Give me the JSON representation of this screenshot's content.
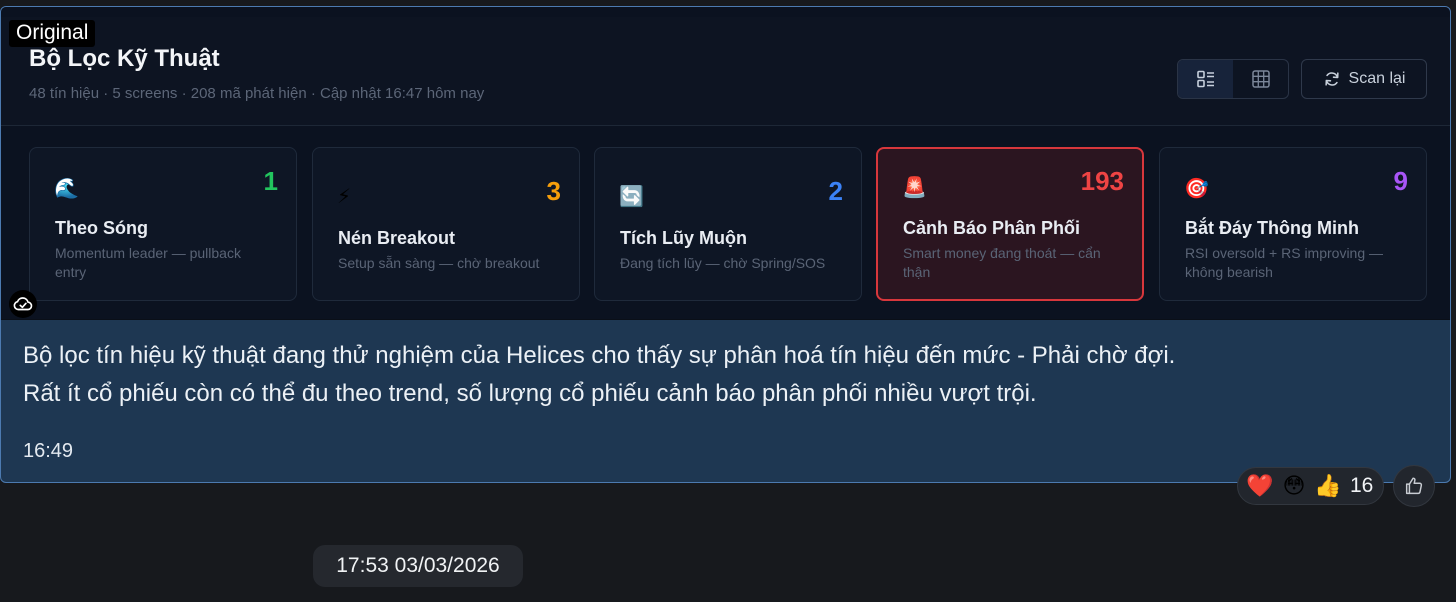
{
  "tag": {
    "label": "Original"
  },
  "header": {
    "title": "Bộ Lọc Kỹ Thuật",
    "meta": "48 tín hiệu · 5 screens · 208 mã phát hiện · Cập nhật 16:47 hôm nay",
    "view_toggle": {
      "options": [
        "list-icon",
        "grid-icon"
      ],
      "active": "list-icon"
    },
    "scan_button": {
      "label": "Scan lại",
      "icon": "refresh-icon"
    }
  },
  "cards": [
    {
      "icon": "🌊",
      "count": "1",
      "count_color": "#22c55e",
      "title": "Theo Sóng",
      "desc": "Momentum leader — pullback entry",
      "alert": false
    },
    {
      "icon": "⚡",
      "count": "3",
      "count_color": "#f59e0b",
      "title": "Nén Breakout",
      "desc": "Setup sẵn sàng — chờ breakout",
      "alert": false
    },
    {
      "icon": "🔄",
      "count": "2",
      "count_color": "#3b82f6",
      "title": "Tích Lũy Muộn",
      "desc": "Đang tích lũy — chờ Spring/SOS",
      "alert": false
    },
    {
      "icon": "🚨",
      "count": "193",
      "count_color": "#ef4444",
      "title": "Cảnh Báo Phân Phối",
      "desc": "Smart money đang thoát — cẩn thận",
      "alert": true
    },
    {
      "icon": "🎯",
      "count": "9",
      "count_color": "#a855f7",
      "title": "Bắt Đáy Thông Minh",
      "desc": "RSI oversold + RS improving — không bearish",
      "alert": false
    }
  ],
  "message": {
    "line1": "Bộ lọc tín hiệu kỹ thuật đang thử nghiệm của Helices cho thấy sự phân hoá tín hiệu đến mức - Phải chờ đợi.",
    "line2": "Rất ít cổ phiếu còn có thể đu theo trend, số lượng cổ  phiếu cảnh báo phân phối nhiều vượt trội.",
    "time": "16:49"
  },
  "reactions": {
    "emojis": [
      "❤️",
      "😳",
      "👍"
    ],
    "count": "16"
  },
  "date_separator": "17:53 03/03/2026",
  "colors": {
    "bubble_bg": "#1e3752",
    "bubble_border": "#4c7ab0",
    "screenshot_bg": "#0b1220",
    "alert_border": "#d8373c"
  }
}
